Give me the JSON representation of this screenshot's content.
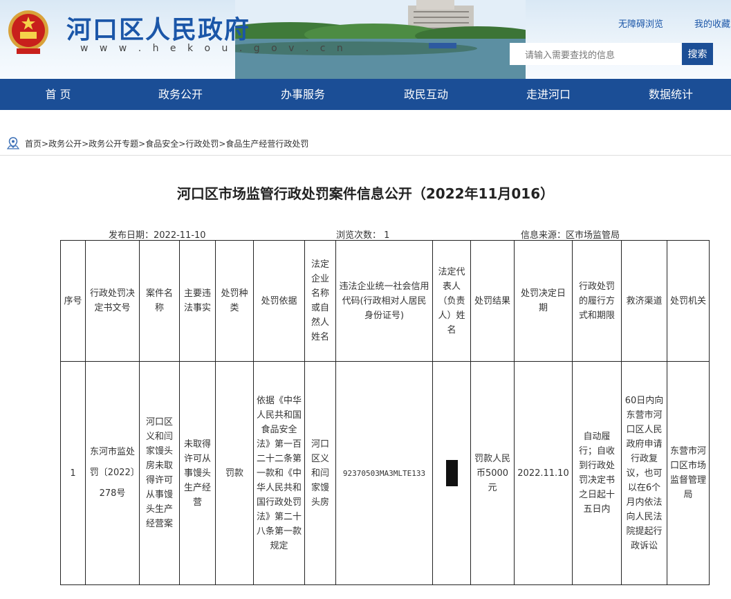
{
  "header": {
    "site_title": "河口区人民政府",
    "site_url": "w w w . h e k o u . g o v . c n",
    "accessibility_link": "无障碍浏览",
    "favorites_link": "我的收藏",
    "search_placeholder": "请输入需要查找的信息",
    "search_button": "搜索"
  },
  "nav": {
    "items": [
      {
        "label": "首 页"
      },
      {
        "label": "政务公开"
      },
      {
        "label": "办事服务"
      },
      {
        "label": "政民互动"
      },
      {
        "label": "走进河口"
      },
      {
        "label": "数据统计"
      }
    ]
  },
  "breadcrumb": [
    "首页",
    "政务公开",
    "政务公开专题",
    "食品安全",
    "行政处罚",
    "食品生产经营行政处罚"
  ],
  "article": {
    "title": "河口区市场监管行政处罚案件信息公开（2022年11月016）",
    "publish_date": "发布日期：2022-11-10",
    "views": "浏览次数：  1",
    "source": "信息来源：区市场监管局"
  },
  "table": {
    "headers": [
      "序号",
      "行政处罚决定书文号",
      "案件名称",
      "主要违法事实",
      "处罚种类",
      "处罚依据",
      "法定企业名称或自然人姓名",
      "违法企业统一社会信用代码(行政相对人居民身份证号)",
      "法定代表人（负责人）姓名",
      "处罚结果",
      "处罚决定日期",
      "行政处罚的履行方式和期限",
      "救济渠道",
      "处罚机关"
    ],
    "row": {
      "index": "1",
      "doc_number": "东河市监处罚〔2022〕278号",
      "case_name": "河口区义和闫家馒头房未取得许可从事馒头生产经营案",
      "facts": "未取得许可从事馒头生产经营",
      "penalty_type": "罚款",
      "basis": "依据《中华人民共和国食品安全法》第一百二十二条第一款和《中华人民共和国行政处罚法》第二十八条第一款规定",
      "entity": "河口区义和闫家馒头房",
      "credit_code": "92370503MA3MLTE133",
      "legal_rep": "",
      "result": "罚款人民币5000元",
      "date": "2022.11.10",
      "execution": "自动履行；自收到行政处罚决定书之日起十五日内",
      "remedy": "60日内向东营市河口区人民政府申请行政复议，也可以在6个月内依法向人民法院提起行政诉讼",
      "authority": "东营市河口区市场监督管理局"
    }
  },
  "colors": {
    "nav_bg": "#1b4e96",
    "title_blue": "#1b56a8"
  }
}
